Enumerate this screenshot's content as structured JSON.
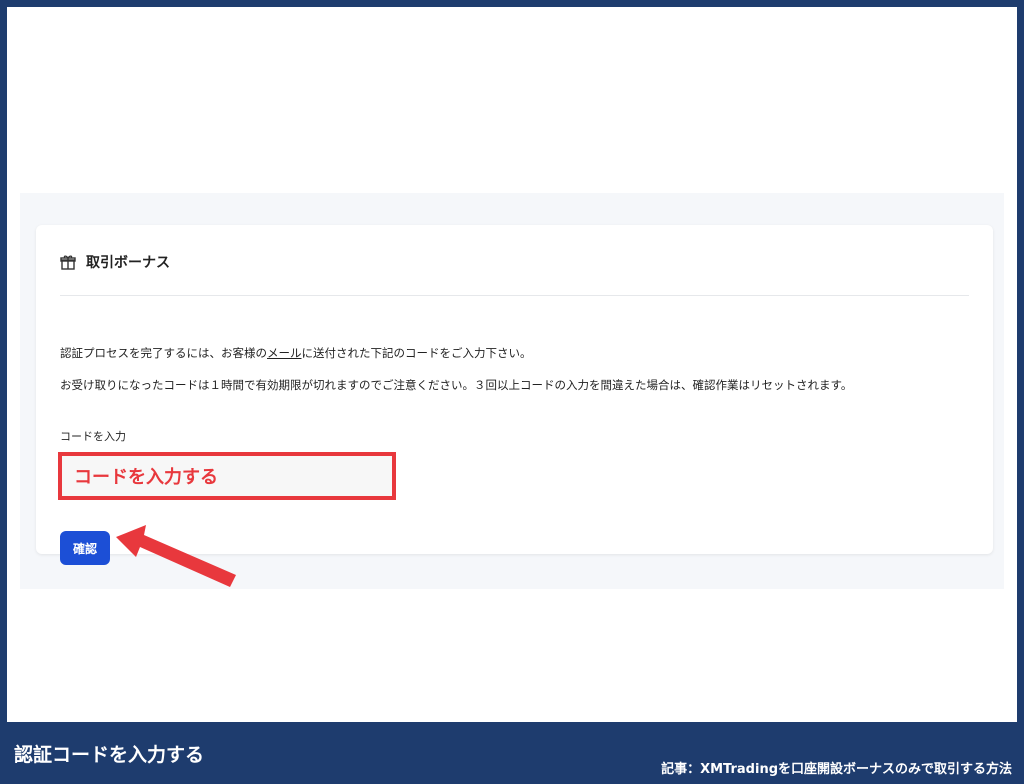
{
  "card": {
    "title": "取引ボーナス",
    "title_icon": "gift-icon",
    "para1_before": "認証プロセスを完了するには、お客様の",
    "para1_link": "メール",
    "para1_after": "に送付された下記のコードをご入力下さい。",
    "para2": "お受け取りになったコードは１時間で有効期限が切れますのでご注意ください。３回以上コードの入力を間違えた場合は、確認作業はリセットされます。"
  },
  "form": {
    "code_label": "コードを入力",
    "code_placeholder": "コードを入力する",
    "confirm_label": "確認"
  },
  "footer": {
    "caption": "認証コードを入力する",
    "article": "記事：XMTradingを口座開設ボーナスのみで取引する方法"
  },
  "colors": {
    "frame": "#1e3c6e",
    "highlight": "#e8383d",
    "button": "#1c4fd6"
  }
}
